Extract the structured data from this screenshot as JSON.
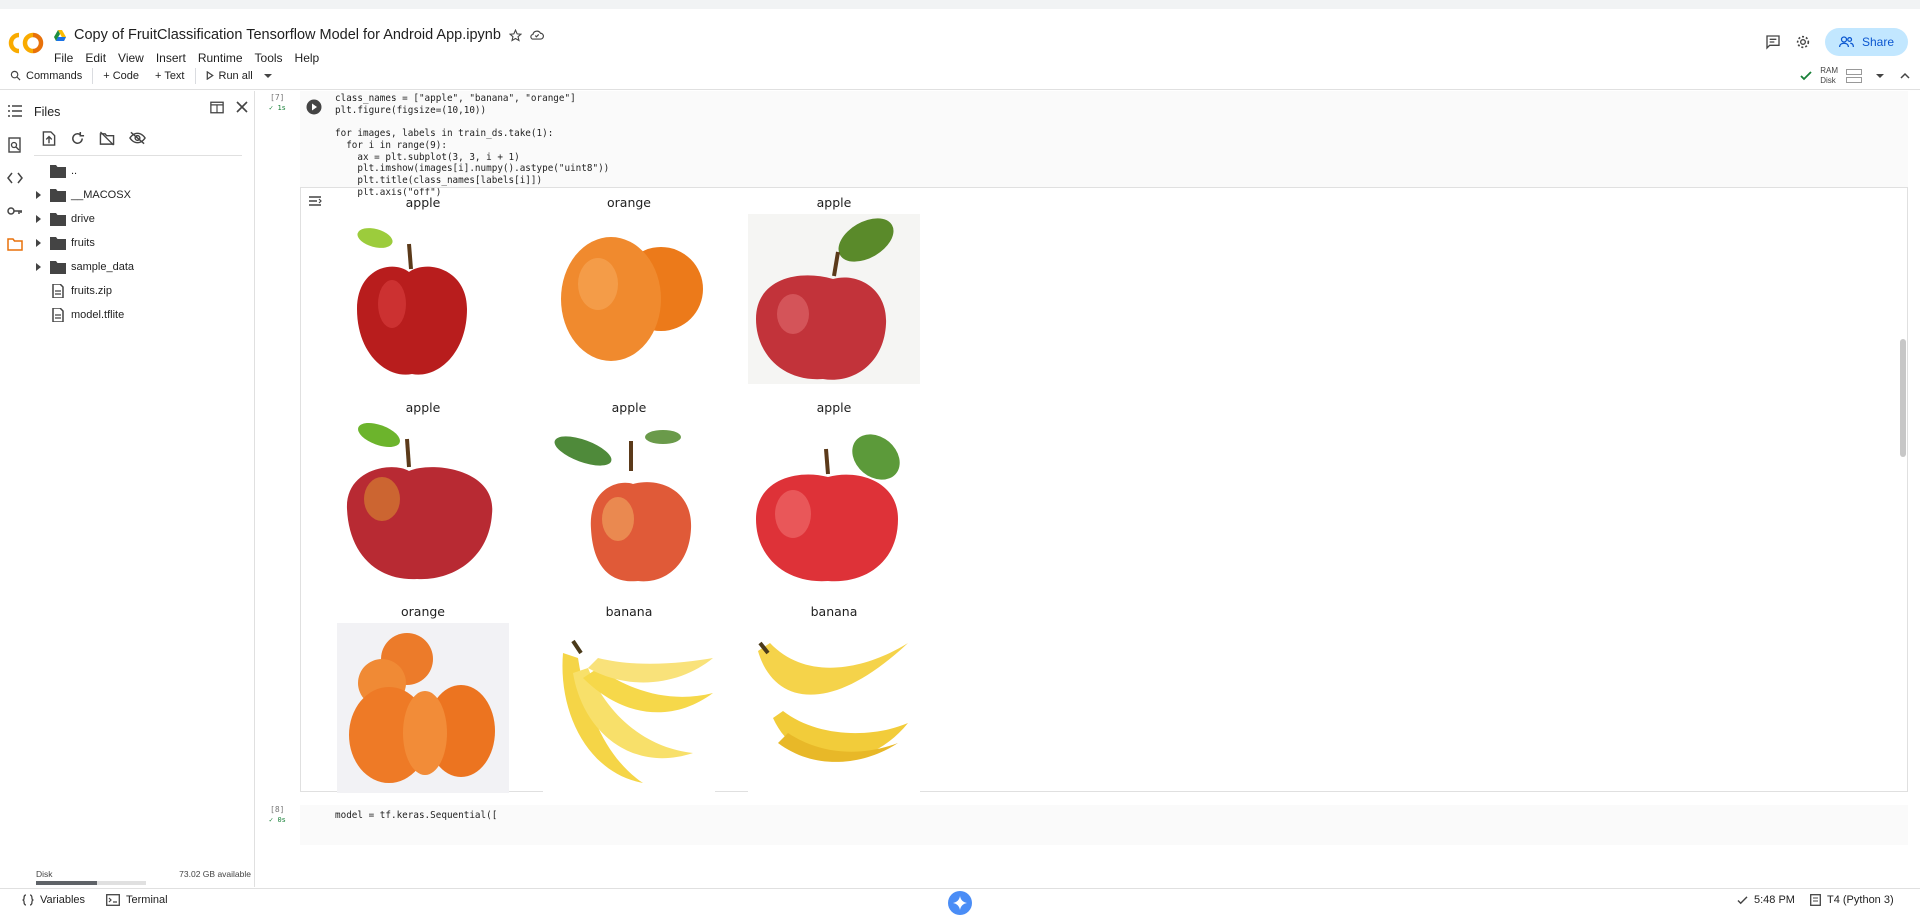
{
  "window": {
    "doc_title": "Copy of FruitClassification Tensorflow Model for Android App.ipynb",
    "share_label": "Share"
  },
  "menu": [
    "File",
    "Edit",
    "View",
    "Insert",
    "Runtime",
    "Tools",
    "Help"
  ],
  "toolbar": {
    "commands": "Commands",
    "code": "+ Code",
    "text": "+ Text",
    "run_all": "Run all",
    "ram": "RAM",
    "disk": "Disk"
  },
  "files": {
    "title": "Files",
    "tree": [
      {
        "label": "..",
        "type": "folder",
        "expandable": false
      },
      {
        "label": "__MACOSX",
        "type": "folder",
        "expandable": true
      },
      {
        "label": "drive",
        "type": "folder",
        "expandable": true
      },
      {
        "label": "fruits",
        "type": "folder",
        "expandable": true
      },
      {
        "label": "sample_data",
        "type": "folder",
        "expandable": true
      },
      {
        "label": "fruits.zip",
        "type": "file",
        "expandable": false
      },
      {
        "label": "model.tflite",
        "type": "file",
        "expandable": false
      }
    ],
    "disk_label": "Disk",
    "disk_available": "73.02 GB available",
    "disk_used_fraction": 0.55
  },
  "cell7": {
    "exec_count": "[7]",
    "exec_time": "1s",
    "code_lines": [
      "class_names = [\"apple\", \"banana\", \"orange\"]",
      "plt.figure(figsize=(10,10))",
      "",
      "for images, labels in train_ds.take(1):",
      "  for i in range(9):",
      "    ax = plt.subplot(3, 3, i + 1)",
      "    plt.imshow(images[i].numpy().astype(\"uint8\"))",
      "    plt.title(class_names[labels[i]])",
      "    plt.axis(\"off\")"
    ]
  },
  "output_titles": [
    "apple",
    "orange",
    "apple",
    "apple",
    "apple",
    "apple",
    "orange",
    "banana",
    "banana"
  ],
  "cell8": {
    "exec_count": "[8]",
    "exec_time": "0s",
    "code_line": "model = tf.keras.Sequential(["
  },
  "status": {
    "variables": "Variables",
    "terminal": "Terminal",
    "time": "5:48 PM",
    "runtime": "T4 (Python 3)"
  },
  "colors": {
    "accent": "#e8710a",
    "share_bg": "#c2e7ff",
    "share_text": "#0b57d0",
    "ok_green": "#188038"
  }
}
